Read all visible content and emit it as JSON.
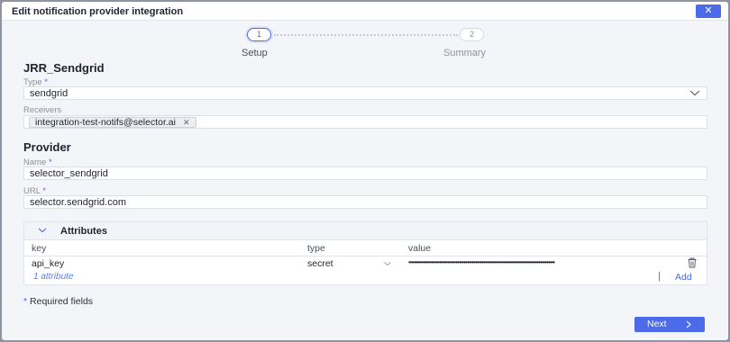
{
  "dialog": {
    "title": "Edit notification provider integration",
    "close_label": "✕"
  },
  "stepper": {
    "steps": [
      {
        "number": "1",
        "label": "Setup"
      },
      {
        "number": "2",
        "label": "Summary"
      }
    ],
    "active_index": 0
  },
  "integration": {
    "name": "JRR_Sendgrid",
    "type_label": "Type",
    "type_value": "sendgrid",
    "receivers_label": "Receivers",
    "receivers": [
      "integration-test-notifs@selector.ai"
    ],
    "chip_remove": "✕"
  },
  "provider": {
    "section_title": "Provider",
    "name_label": "Name",
    "name_value": "selector_sendgrid",
    "url_label": "URL",
    "url_value": "selector.sendgrid.com"
  },
  "attributes": {
    "title": "Attributes",
    "columns": {
      "key": "key",
      "type": "type",
      "value": "value"
    },
    "rows": [
      {
        "key": "api_key",
        "type": "secret",
        "value": "••••••••••••••••••••••••••••••••••••••••••••••••••••••••••••••••••••••••••••••••••••••••••"
      }
    ],
    "count_text": "1 attribute",
    "separator": "|",
    "add_label": "Add"
  },
  "footer": {
    "required_note": "Required fields",
    "required_marker": "*",
    "next_label": "Next"
  },
  "icons": {
    "chevron": "chevron-down-icon",
    "close": "close-icon",
    "trash": "trash-icon",
    "next": "chevron-right-icon"
  },
  "colors": {
    "accent": "#4b6bea",
    "panel": "#f4f5f8",
    "backdrop": "#8f95a0"
  }
}
